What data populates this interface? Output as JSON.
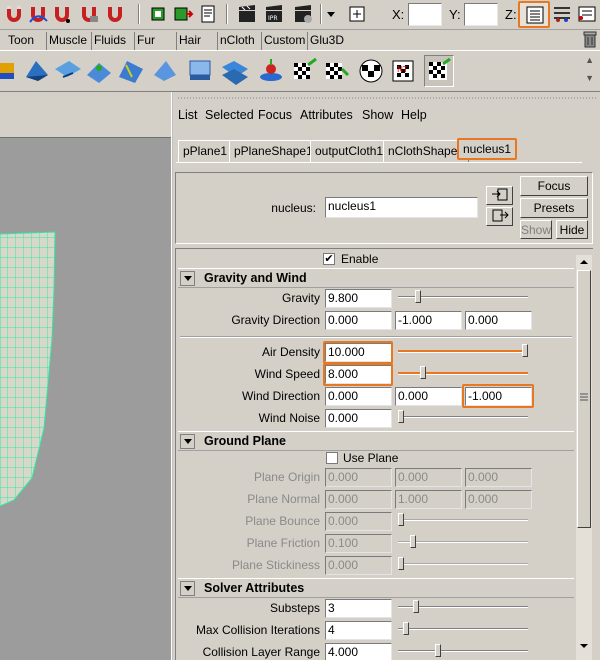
{
  "status_line": {
    "coord_x_label": "X:",
    "coord_y_label": "Y:",
    "coord_z_label": "Z:",
    "icons": [
      "magnet-snap-grid-icon",
      "magnet-snap-curve-icon",
      "magnet-snap-point-icon",
      "magnet-snap-view-icon",
      "magnet-snap-surface-icon",
      "input-history-icon",
      "output-history-icon",
      "construction-history-icon",
      "render-frame-icon",
      "render-ipr-icon",
      "render-settings-icon",
      "transform-field-icon",
      "attribute-editor-toggle-icon",
      "channel-box-toggle-icon",
      "toolbox-toggle-icon"
    ]
  },
  "shelf_tabs": [
    "Toon",
    "Muscle",
    "Fluids",
    "Fur",
    "Hair",
    "nCloth",
    "Custom",
    "Glu3D"
  ],
  "ae_menu": [
    "List",
    "Selected",
    "Focus",
    "Attributes",
    "Show",
    "Help"
  ],
  "node_tabs": [
    "pPlane1",
    "pPlaneShape1",
    "outputCloth1",
    "nClothShape1",
    "nucleus1"
  ],
  "header": {
    "node_label": "nucleus:",
    "node_value": "nucleus1",
    "focus_label": "Focus",
    "presets_label": "Presets",
    "show_label": "Show",
    "hide_label": "Hide"
  },
  "enable": {
    "label": "Enable",
    "checked": "✔"
  },
  "gravity_wind": {
    "title": "Gravity and Wind",
    "gravity_label": "Gravity",
    "gravity_value": "9.800",
    "gravity_slider": 0.14,
    "gravity_dir_label": "Gravity Direction",
    "gravity_dir": [
      "0.000",
      "-1.000",
      "0.000"
    ],
    "air_density_label": "Air Density",
    "air_density_value": "10.000",
    "air_density_slider": 1.0,
    "wind_speed_label": "Wind Speed",
    "wind_speed_value": "8.000",
    "wind_speed_slider": 0.18,
    "wind_dir_label": "Wind Direction",
    "wind_dir": [
      "0.000",
      "0.000",
      "-1.000"
    ],
    "wind_noise_label": "Wind Noise",
    "wind_noise_value": "0.000",
    "wind_noise_slider": 0.0
  },
  "ground_plane": {
    "title": "Ground Plane",
    "use_plane_label": "Use Plane",
    "origin_label": "Plane Origin",
    "origin": [
      "0.000",
      "0.000",
      "0.000"
    ],
    "normal_label": "Plane Normal",
    "normal": [
      "0.000",
      "1.000",
      "0.000"
    ],
    "bounce_label": "Plane Bounce",
    "bounce_value": "0.000",
    "bounce_slider": 0.0,
    "friction_label": "Plane Friction",
    "friction_value": "0.100",
    "friction_slider": 0.1,
    "stickiness_label": "Plane Stickiness",
    "stickiness_value": "0.000",
    "stickiness_slider": 0.0
  },
  "solver": {
    "title": "Solver Attributes",
    "substeps_label": "Substeps",
    "substeps_value": "3",
    "substeps_slider": 0.12,
    "max_coll_label": "Max Collision Iterations",
    "max_coll_value": "4",
    "max_coll_slider": 0.04,
    "coll_layer_label": "Collision Layer Range",
    "coll_layer_value": "4.000",
    "coll_layer_slider": 0.3
  },
  "colors": {
    "highlight": "#e87722",
    "cloth_mesh": "#2ee8a8",
    "viewport_bg": "#9c9c9c"
  }
}
